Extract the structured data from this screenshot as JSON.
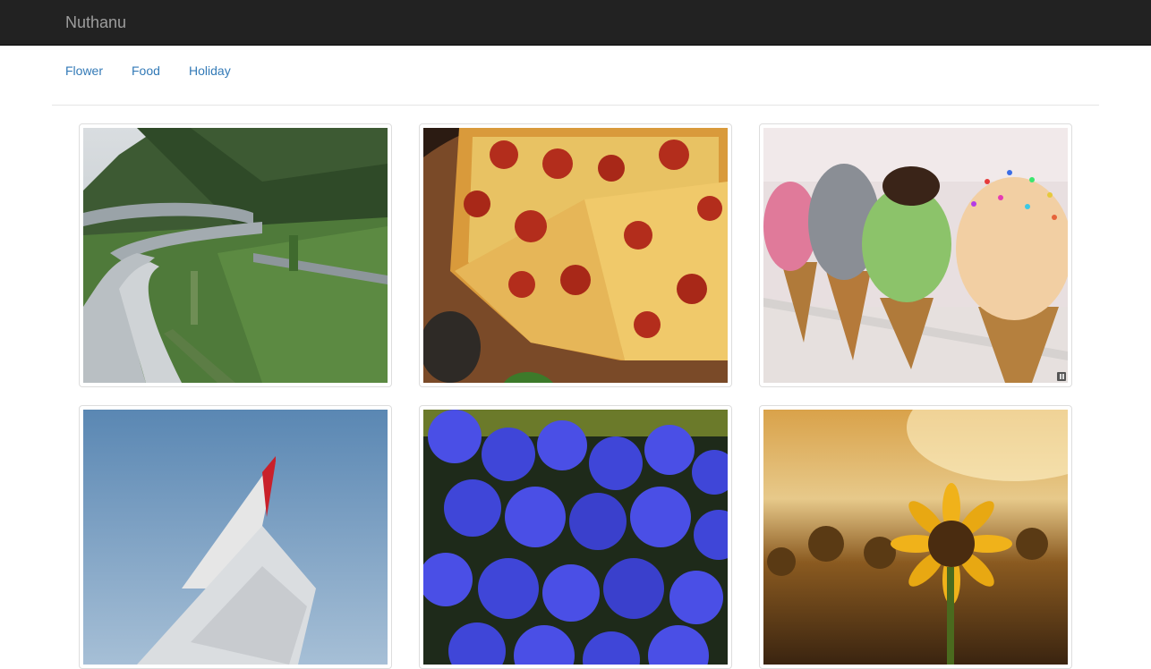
{
  "navbar": {
    "brand": "Nuthanu"
  },
  "categories": [
    {
      "label": "Flower"
    },
    {
      "label": "Food"
    },
    {
      "label": "Holiday"
    }
  ],
  "gallery": [
    {
      "subject": "mountain highway viaduct"
    },
    {
      "subject": "pepperoni pizza"
    },
    {
      "subject": "ice cream cones"
    },
    {
      "subject": "airplane wing in sky"
    },
    {
      "subject": "blue roses"
    },
    {
      "subject": "sunflower field at sunset"
    }
  ]
}
